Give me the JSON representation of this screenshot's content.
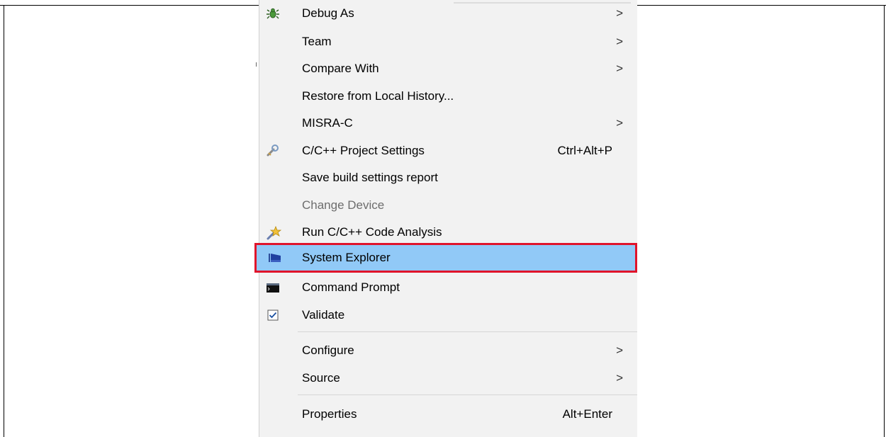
{
  "menu": {
    "items": [
      {
        "label": "Debug As",
        "icon": "bug-icon",
        "submenu": true
      },
      {
        "label": "Team",
        "submenu": true
      },
      {
        "label": "Compare With",
        "submenu": true
      },
      {
        "label": "Restore from Local History..."
      },
      {
        "label": "MISRA-C",
        "submenu": true
      },
      {
        "label": "C/C++ Project Settings",
        "icon": "wrench-icon",
        "shortcut": "Ctrl+Alt+P"
      },
      {
        "label": "Save build settings report"
      },
      {
        "label": "Change Device",
        "disabled": true
      },
      {
        "label": "Run C/C++ Code Analysis",
        "icon": "code-analysis-icon"
      },
      {
        "label": "System Explorer",
        "icon": "system-explorer-icon",
        "highlighted": true
      },
      {
        "label": "Command Prompt",
        "icon": "terminal-icon"
      },
      {
        "label": "Validate",
        "icon": "checkbox-icon",
        "checked": true
      },
      {
        "label": "Configure",
        "submenu": true
      },
      {
        "label": "Source",
        "submenu": true
      },
      {
        "label": "Properties",
        "shortcut": "Alt+Enter"
      }
    ],
    "submenu_arrow": ">",
    "highlight_border_color": "#e0142b",
    "highlight_fill_color": "#91c9f7"
  }
}
